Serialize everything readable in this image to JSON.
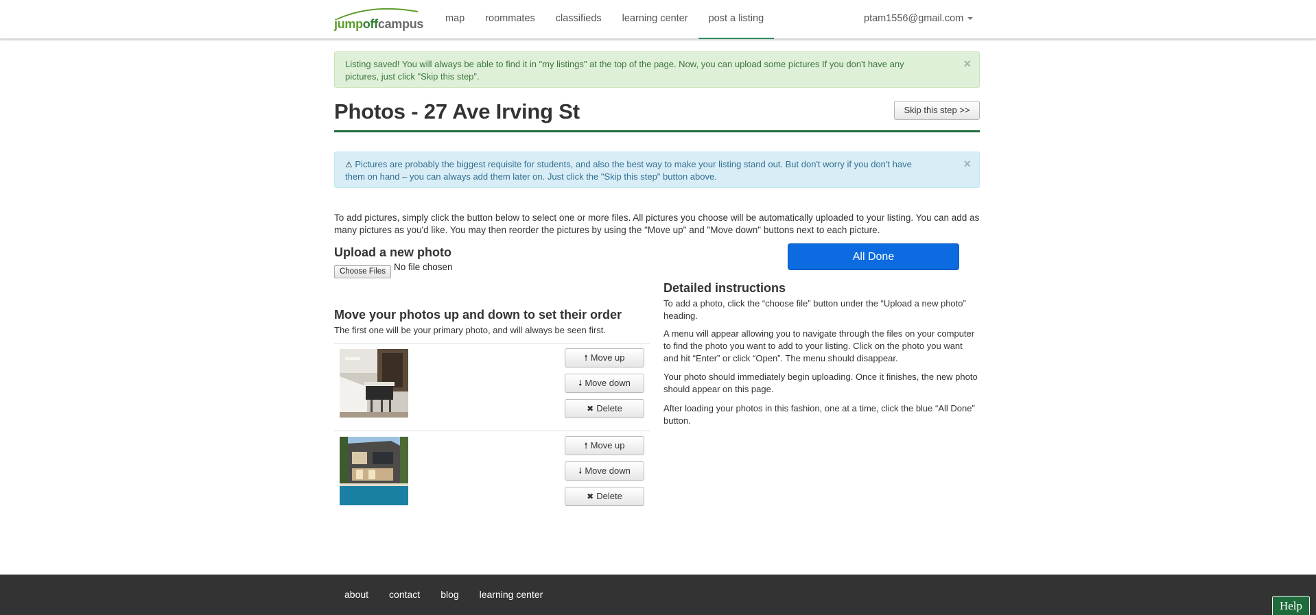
{
  "nav": {
    "logo": {
      "part1": "jump",
      "part2": "off",
      "part3": "campus"
    },
    "links": [
      "map",
      "roommates",
      "classifieds",
      "learning center",
      "post a listing"
    ],
    "active": "post a listing",
    "user_email": "ptam1556@gmail.com"
  },
  "alerts": {
    "success": "Listing saved! You will always be able to find it in \"my listings\" at the top of the page. Now, you can upload some pictures If you don't have any pictures, just click \"Skip this step\".",
    "info": "Pictures are probably the biggest requisite for students, and also the best way to make your listing stand out. But don't worry if you don't have them on hand – you can always add them later on. Just click the \"Skip this step\" button above.",
    "close_glyph": "×"
  },
  "page": {
    "title": "Photos - 27 Ave Irving St",
    "skip_label": "Skip this step >>",
    "intro": "To add pictures, simply click the button below to select one or more files. All pictures you choose will be automatically uploaded to your listing. You can add as many pictures as you'd like. You may then reorder the pictures by using the \"Move up\" and \"Move down\" buttons next to each picture."
  },
  "upload": {
    "heading": "Upload a new photo",
    "file_button": "Choose Files",
    "file_status": "No file chosen",
    "all_done": "All Done"
  },
  "order": {
    "heading": "Move your photos up and down to set their order",
    "subtext": "The first one will be your primary photo, and will always be seen first.",
    "move_up": "Move up",
    "move_down": "Move down",
    "delete": "Delete"
  },
  "instructions": {
    "heading": "Detailed instructions",
    "paragraphs": [
      "To add a photo, click the “choose file” button under the “Upload a new photo” heading.",
      "A menu will appear allowing you to navigate through the files on your computer to find the photo you want to add to your listing. Click on the photo you want and hit “Enter” or click “Open”. The menu should disappear.",
      "Your photo should immediately begin uploading. Once it finishes, the new photo should appear on this page.",
      "After loading your photos in this fashion, one at a time, click the blue “All Done” button."
    ]
  },
  "footer": {
    "links": [
      "about",
      "contact",
      "blog",
      "learning center"
    ],
    "help": "Help"
  },
  "colors": {
    "brand_green": "#1f6b3c",
    "all_done_blue": "#0c6be0",
    "footer_bg": "#333333"
  }
}
